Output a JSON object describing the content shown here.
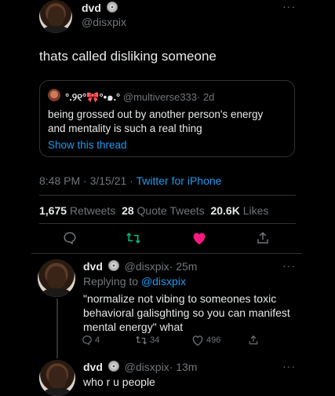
{
  "main_tweet": {
    "display_name": "dvd",
    "handle": "@disxpix",
    "text": "thats called disliking someone",
    "quoted": {
      "display_name": "°.୨୧°🎀°•๑.°",
      "handle": "@multiverse333",
      "time": "· 2d",
      "text": "being grossed out by another person's energy and mentality is such a real thing",
      "show_thread": "Show this thread"
    },
    "timestamp": "8:48 PM · 3/15/21 ·",
    "source": "Twitter for iPhone",
    "stats": {
      "retweets_count": "1,675",
      "retweets_label": "Retweets",
      "quotes_count": "28",
      "quotes_label": "Quote Tweets",
      "likes_count": "20.6K",
      "likes_label": "Likes"
    },
    "actions": [
      "reply-icon",
      "retweet-icon",
      "like-icon-filled",
      "share-icon"
    ],
    "colors": {
      "retweet": "#00ba7c",
      "like": "#f91880",
      "link": "#1d9bf0"
    }
  },
  "replies": [
    {
      "display_name": "dvd",
      "handle": "@disxpix",
      "time": "· 25m",
      "replying_label": "Replying to",
      "replying_handle": "@disxpix",
      "text": "\"normalize not vibing to someones toxic behavioral galisghting so you can manifest mental energy\" what",
      "reply_count": "4",
      "retweet_count": "34",
      "like_count": "496"
    },
    {
      "display_name": "dvd",
      "handle": "@disxpix",
      "time": "· 13m",
      "text": "who r u people"
    }
  ],
  "more_label": "···"
}
